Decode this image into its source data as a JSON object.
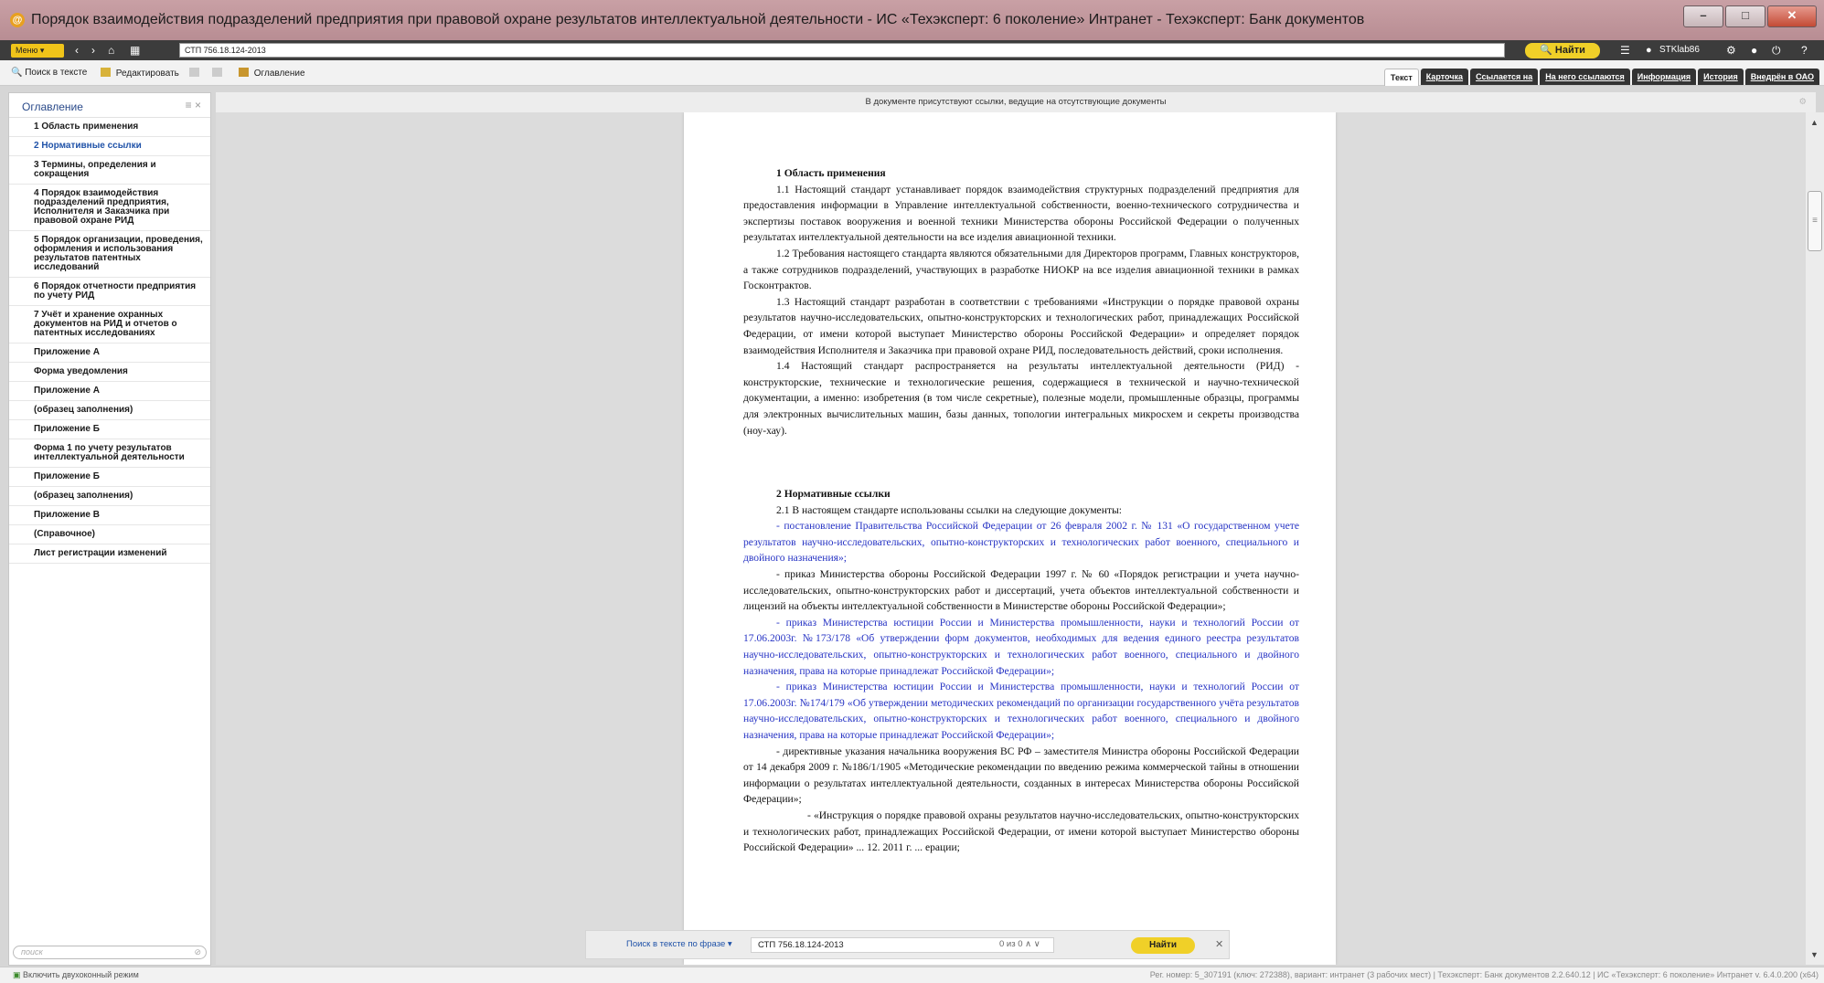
{
  "window": {
    "title": "Порядок взаимодействия подразделений предприятия при правовой охране результатов интеллектуальной деятельности - ИС «Техэксперт: 6 поколение» Интранет - Техэксперт: Банк документов",
    "minimize": "–",
    "maximize": "□",
    "close": "✕"
  },
  "toolbar": {
    "menu_label": "Меню ▾",
    "back_icon": "‹",
    "forward_icon": "›",
    "home_icon": "⌂",
    "grid_icon": "▦",
    "address": "СТП 756.18.124-2013",
    "find_label": "🔍 Найти",
    "user": "STKlab86"
  },
  "toolbar2": {
    "search_in_text": "Поиск в тексте",
    "edit": "Редактировать",
    "toc": "Оглавление",
    "tabs": [
      "Текст",
      "Карточка",
      "Ссылается на",
      "На него ссылаются",
      "Информация",
      "История",
      "Внедрён в ОАО"
    ]
  },
  "sidebar": {
    "title": "Оглавление",
    "controls": "≡ ×",
    "items": [
      "1 Область применения",
      "2 Нормативные ссылки",
      "3 Термины, определения и сокращения",
      "4 Порядок взаимодействия подразделений предприятия, Исполнителя и Заказчика при правовой охране РИД",
      "5 Порядок организации, проведения, оформления и использования результатов патентных исследований",
      "6 Порядок отчетности предприятия по учету РИД",
      "7 Учёт и хранение охранных документов на РИД и отчетов о патентных исследованиях",
      "Приложение А",
      "Форма уведомления",
      "Приложение А",
      "(образец заполнения)",
      "Приложение Б",
      "Форма 1 по учету результатов интеллектуальной деятельности",
      "Приложение Б",
      "(образец заполнения)",
      "Приложение В",
      " (Справочное)",
      "Лист регистрации изменений"
    ],
    "search_placeholder": "поиск"
  },
  "notice": "В документе присутствуют ссылки, ведущие на отсутствующие документы",
  "document": {
    "h1": "1 Область применения",
    "p1_1": "1.1 Настоящий стандарт устанавливает порядок взаимодействия структурных подразделений предприятия для предоставления информации в Управление интеллектуальной собственности, военно-технического сотрудничества и экспертизы поставок вооружения и военной техники Министерства обороны Российской Федерации о полученных результатах интеллектуальной деятельности на все изделия авиационной техники.",
    "p1_2": "1.2 Требования настоящего стандарта являются обязательными для Директоров программ, Главных конструкторов, а также сотрудников подразделений, участвующих в разработке НИОКР на все изделия авиационной техники в рамках Госконтрактов.",
    "p1_3": "1.3 Настоящий стандарт разработан в соответствии с требованиями «Инструкции о порядке правовой охраны результатов научно-исследовательских, опытно-конструкторских и технологических работ, принадлежащих Российской Федерации, от имени которой выступает Министерство обороны Российской Федерации» и определяет порядок взаимодействия Исполнителя и Заказчика при правовой охране РИД, последовательность действий, сроки исполнения.",
    "p1_4": "1.4 Настоящий стандарт  распространяется на результаты интеллектуальной деятельности (РИД) - конструкторские, технические и технологические решения, содержащиеся в технической и научно-технической документации, а именно: изобретения (в том числе секретные), полезные модели, промышленные образцы, программы для электронных вычислительных машин, базы данных, топологии интегральных микросхем и секреты производства (ноу-хау).",
    "h2": "2 Нормативные ссылки",
    "p2_1": "2.1 В настоящем стандарте использованы ссылки на следующие документы:",
    "ref1": "- постановление Правительства Российской Федерации от 26 февраля 2002 г. № 131 «О государственном учете результатов научно-исследовательских, опытно-конструкторских и технологических работ военного, специального и двойного назначения»;",
    "ref2": "-   приказ Министерства обороны Российской Федерации 1997 г. № 60 «Порядок регистрации и учета научно-исследовательских, опытно-конструкторских работ и диссертаций, учета объектов интеллектуальной собственности и лицензий на объекты интеллектуальной собственности в Министерстве обороны Российской Федерации»;",
    "ref3": "- приказ Министерства юстиции России и Министерства   промышленности, науки и технологий   России от   17.06.2003г.  №173/178 «Об утверждении форм документов, необходимых для ведения единого реестра результатов научно-исследовательских, опытно-конструкторских и технологических работ военного, специального и двойного назначения, права на которые принадлежат Российской Федерации»;",
    "ref4": "- приказ Министерства юстиции России и Министерства   промышленности, науки и технологий России от 17.06.2003г. №174/179 «Об утверждении методических рекомендаций по организации государственного учёта результатов научно-исследовательских, опытно-конструкторских и технологических работ военного, специального и двойного назначения, права на которые принадлежат Российской Федерации»;",
    "ref5": "- директивные указания начальника вооружения ВС РФ – заместителя Министра обороны Российской Федерации от 14 декабря 2009 г. №186/1/1905 «Методические рекомендации по введению режима коммерческой тайны в отношении информации о результатах интеллектуальной деятельности, созданных в интересах Министерства обороны Российской Федерации»;",
    "ref6": "- «Инструкция о порядке правовой охраны результатов научно-исследовательских, опытно-конструкторских и технологических работ, принадлежащих Российской Федерации, от имени которой выступает Министерство обороны Российской Федерации» ... 12. 2011 г. ... ерации;"
  },
  "findbar": {
    "label": "Поиск в тексте по фразе  ▾",
    "value": "СТП 756.18.124-2013",
    "count": "0 из 0   ∧   ∨",
    "find_label": "Найти",
    "close": "✕"
  },
  "status": {
    "left": "Включить двухоконный режим",
    "right": "Рег. номер: 5_307191 (ключ: 272388), вариант: интранет (3 рабочих мест)  |  Техэксперт: Банк документов 2.2.640.12  |  ИС «Техэксперт: 6 поколение» Интранет v. 6.4.0.200 (x64)"
  }
}
